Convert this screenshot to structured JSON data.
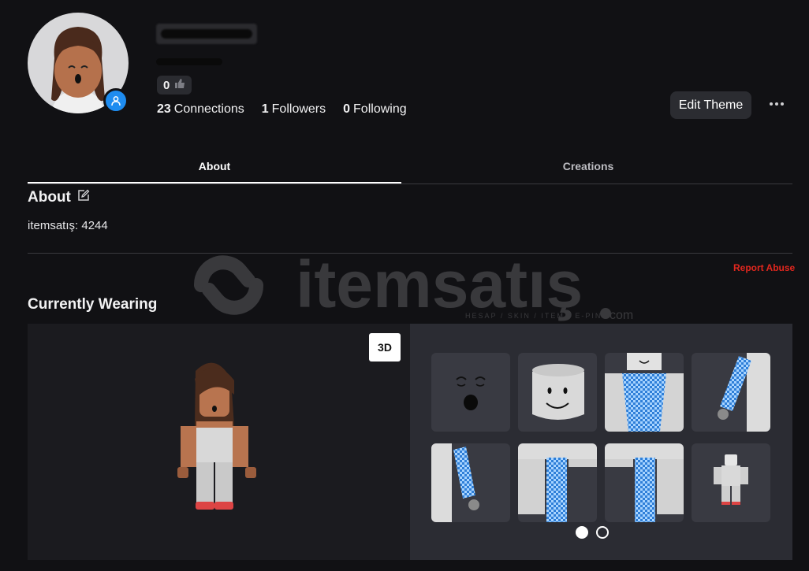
{
  "profile": {
    "username": "",
    "display_name": "",
    "votes": "0",
    "stats": [
      {
        "count": "23",
        "label": "Connections"
      },
      {
        "count": "1",
        "label": "Followers"
      },
      {
        "count": "0",
        "label": "Following"
      }
    ],
    "edit_theme_label": "Edit Theme"
  },
  "tabs": [
    {
      "label": "About",
      "active": true
    },
    {
      "label": "Creations",
      "active": false
    }
  ],
  "about": {
    "title": "About",
    "text": "itemsatış: 4244",
    "report_label": "Report Abuse"
  },
  "watermark": {
    "brand": "itemsatış",
    "tagline": "HESAP / SKIN / ITEM / E-PIN",
    "suffix": ".com"
  },
  "wearing": {
    "title": "Currently Wearing",
    "view_toggle": "3D",
    "items": [
      {
        "icon": "sleepy-face-icon"
      },
      {
        "icon": "classic-head-icon"
      },
      {
        "icon": "blue-checker-shirt-icon"
      },
      {
        "icon": "right-arm-icon"
      },
      {
        "icon": "left-arm-icon"
      },
      {
        "icon": "left-leg-icon"
      },
      {
        "icon": "right-leg-icon"
      },
      {
        "icon": "mini-avatar-icon"
      }
    ],
    "pages": 2,
    "current_page": 1
  },
  "colors": {
    "background": "#111114",
    "accent_blue": "#1e8cf0",
    "report_red": "#e2271e",
    "panel": "#2b2c33"
  }
}
